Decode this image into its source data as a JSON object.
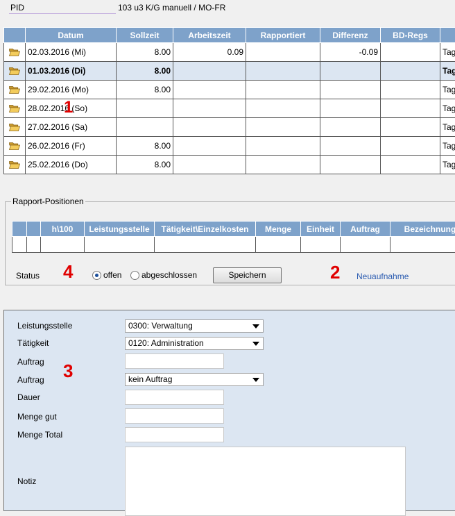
{
  "header": {
    "pid_label": "PID",
    "pid_value": "103 u3 K/G manuell / MO-FR"
  },
  "main_table": {
    "columns": [
      "",
      "Datum",
      "Sollzeit",
      "Arbeitszeit",
      "Rapportiert",
      "Differenz",
      "BD-Regs",
      ""
    ],
    "rows": [
      {
        "datum": "02.03.2016 (Mi)",
        "sollzeit": "8.00",
        "arbeitszeit": "0.09",
        "rapportiert": "",
        "differenz": "-0.09",
        "bdregs": "",
        "last": "Tag",
        "selected": false
      },
      {
        "datum": "01.03.2016 (Di)",
        "sollzeit": "8.00",
        "arbeitszeit": "",
        "rapportiert": "",
        "differenz": "",
        "bdregs": "",
        "last": "Tag",
        "selected": true
      },
      {
        "datum": "29.02.2016 (Mo)",
        "sollzeit": "8.00",
        "arbeitszeit": "",
        "rapportiert": "",
        "differenz": "",
        "bdregs": "",
        "last": "Tag",
        "selected": false
      },
      {
        "datum": "28.02.2016 (So)",
        "sollzeit": "",
        "arbeitszeit": "",
        "rapportiert": "",
        "differenz": "",
        "bdregs": "",
        "last": "Tag",
        "selected": false
      },
      {
        "datum": "27.02.2016 (Sa)",
        "sollzeit": "",
        "arbeitszeit": "",
        "rapportiert": "",
        "differenz": "",
        "bdregs": "",
        "last": "Tag",
        "selected": false
      },
      {
        "datum": "26.02.2016 (Fr)",
        "sollzeit": "8.00",
        "arbeitszeit": "",
        "rapportiert": "",
        "differenz": "",
        "bdregs": "",
        "last": "Tag",
        "selected": false
      },
      {
        "datum": "25.02.2016 (Do)",
        "sollzeit": "8.00",
        "arbeitszeit": "",
        "rapportiert": "",
        "differenz": "",
        "bdregs": "",
        "last": "Tag",
        "selected": false
      }
    ]
  },
  "rapport": {
    "legend": "Rapport-Positionen",
    "columns": [
      "",
      "",
      "h\\100",
      "Leistungsstelle",
      "Tätigkeit\\Einzelkosten",
      "Menge",
      "Einheit",
      "Auftrag",
      "Bezeichnung"
    ],
    "status_label": "Status",
    "radio_open": "offen",
    "radio_closed": "abgeschlossen",
    "save_label": "Speichern",
    "new_link": "Neuaufnahme"
  },
  "markers": {
    "m1": "1",
    "m2": "2",
    "m3": "3",
    "m4": "4"
  },
  "form": {
    "leistungsstelle_label": "Leistungsstelle",
    "leistungsstelle_value": "0300: Verwaltung",
    "taetigkeit_label": "Tätigkeit",
    "taetigkeit_value": "0120: Administration",
    "auftrag_input_label": "Auftrag",
    "auftrag_select_label": "Auftrag",
    "auftrag_select_value": "kein Auftrag",
    "dauer_label": "Dauer",
    "menge_gut_label": "Menge gut",
    "menge_total_label": "Menge Total",
    "notiz_label": "Notiz"
  },
  "colors": {
    "header_bg": "#7ea2ca",
    "selected_row": "#dce6f2",
    "form_bg": "#dce6f2",
    "marker": "#e00000",
    "link": "#2a5bb0"
  },
  "icons": {
    "row_icon": "folder-open-icon"
  }
}
